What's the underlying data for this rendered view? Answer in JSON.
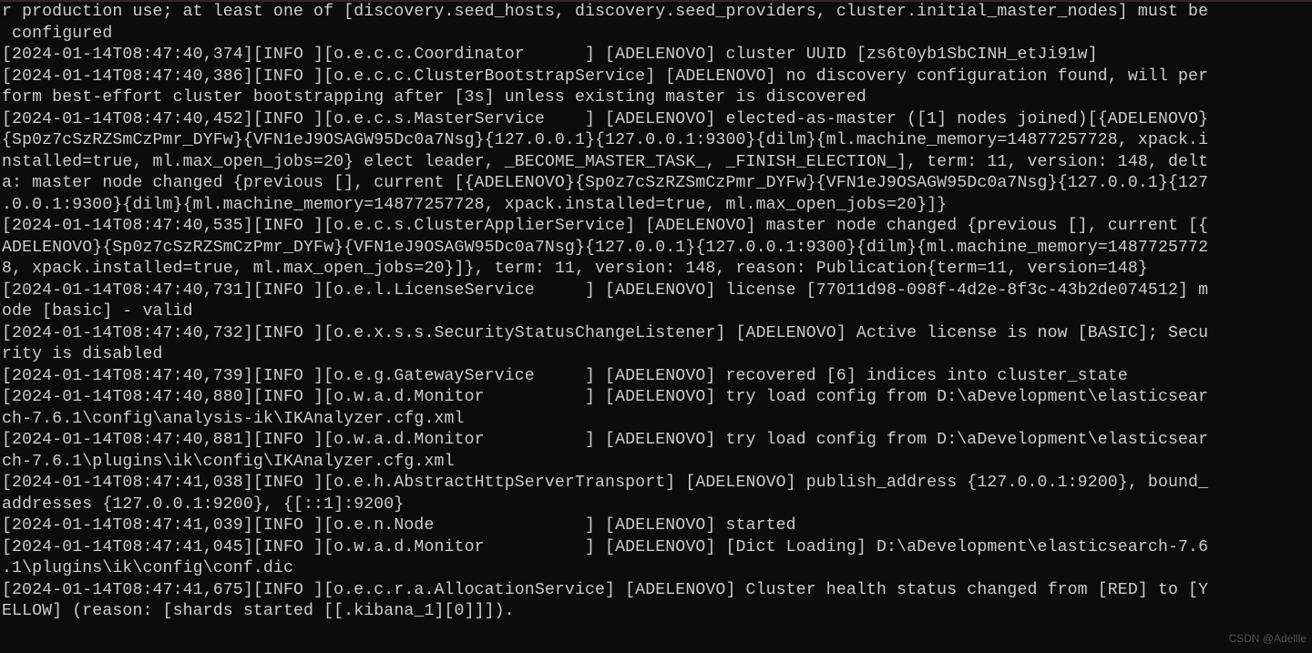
{
  "terminal": {
    "node": "ADELENOVO",
    "lines": [
      "r production use; at least one of [discovery.seed_hosts, discovery.seed_providers, cluster.initial_master_nodes] must be",
      " configured",
      "[2024-01-14T08:47:40,374][INFO ][o.e.c.c.Coordinator      ] [ADELENOVO] cluster UUID [zs6t0yb1SbCINH_etJi91w]",
      "[2024-01-14T08:47:40,386][INFO ][o.e.c.c.ClusterBootstrapService] [ADELENOVO] no discovery configuration found, will per",
      "form best-effort cluster bootstrapping after [3s] unless existing master is discovered",
      "[2024-01-14T08:47:40,452][INFO ][o.e.c.s.MasterService    ] [ADELENOVO] elected-as-master ([1] nodes joined)[{ADELENOVO}",
      "{Sp0z7cSzRZSmCzPmr_DYFw}{VFN1eJ9OSAGW95Dc0a7Nsg}{127.0.0.1}{127.0.0.1:9300}{dilm}{ml.machine_memory=14877257728, xpack.i",
      "nstalled=true, ml.max_open_jobs=20} elect leader, _BECOME_MASTER_TASK_, _FINISH_ELECTION_], term: 11, version: 148, delt",
      "a: master node changed {previous [], current [{ADELENOVO}{Sp0z7cSzRZSmCzPmr_DYFw}{VFN1eJ9OSAGW95Dc0a7Nsg}{127.0.0.1}{127",
      ".0.0.1:9300}{dilm}{ml.machine_memory=14877257728, xpack.installed=true, ml.max_open_jobs=20}]}",
      "[2024-01-14T08:47:40,535][INFO ][o.e.c.s.ClusterApplierService] [ADELENOVO] master node changed {previous [], current [{",
      "ADELENOVO}{Sp0z7cSzRZSmCzPmr_DYFw}{VFN1eJ9OSAGW95Dc0a7Nsg}{127.0.0.1}{127.0.0.1:9300}{dilm}{ml.machine_memory=1487725772",
      "8, xpack.installed=true, ml.max_open_jobs=20}]}, term: 11, version: 148, reason: Publication{term=11, version=148}",
      "[2024-01-14T08:47:40,731][INFO ][o.e.l.LicenseService     ] [ADELENOVO] license [77011d98-098f-4d2e-8f3c-43b2de074512] m",
      "ode [basic] - valid",
      "[2024-01-14T08:47:40,732][INFO ][o.e.x.s.s.SecurityStatusChangeListener] [ADELENOVO] Active license is now [BASIC]; Secu",
      "rity is disabled",
      "[2024-01-14T08:47:40,739][INFO ][o.e.g.GatewayService     ] [ADELENOVO] recovered [6] indices into cluster_state",
      "[2024-01-14T08:47:40,880][INFO ][o.w.a.d.Monitor          ] [ADELENOVO] try load config from D:\\aDevelopment\\elasticsear",
      "ch-7.6.1\\config\\analysis-ik\\IKAnalyzer.cfg.xml",
      "[2024-01-14T08:47:40,881][INFO ][o.w.a.d.Monitor          ] [ADELENOVO] try load config from D:\\aDevelopment\\elasticsear",
      "ch-7.6.1\\plugins\\ik\\config\\IKAnalyzer.cfg.xml",
      "[2024-01-14T08:47:41,038][INFO ][o.e.h.AbstractHttpServerTransport] [ADELENOVO] publish_address {127.0.0.1:9200}, bound_",
      "addresses {127.0.0.1:9200}, {[::1]:9200}",
      "[2024-01-14T08:47:41,039][INFO ][o.e.n.Node               ] [ADELENOVO] started",
      "[2024-01-14T08:47:41,045][INFO ][o.w.a.d.Monitor          ] [ADELENOVO] [Dict Loading] D:\\aDevelopment\\elasticsearch-7.6",
      ".1\\plugins\\ik\\config\\conf.dic",
      "[2024-01-14T08:47:41,675][INFO ][o.e.c.r.a.AllocationService] [ADELENOVO] Cluster health status changed from [RED] to [Y",
      "ELLOW] (reason: [shards started [[.kibana_1][0]]])."
    ]
  },
  "watermark": "CSDN @Adellle"
}
